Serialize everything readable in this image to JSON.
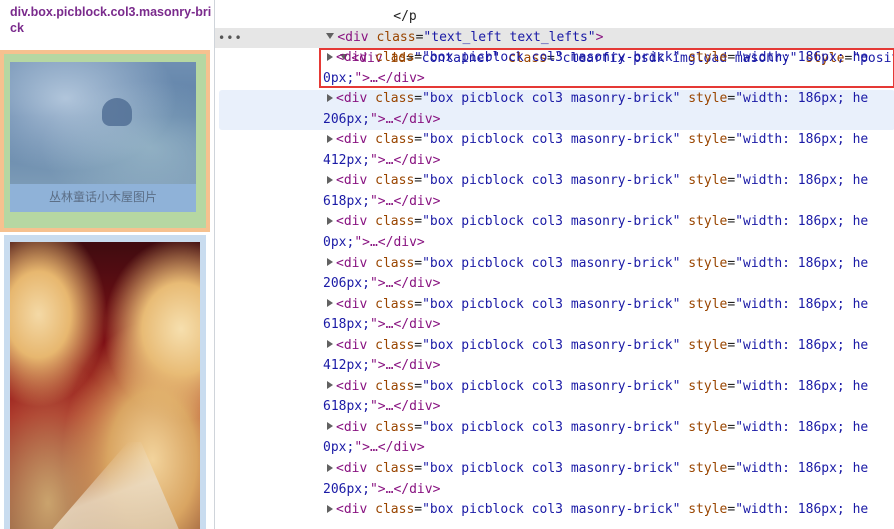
{
  "tooltip": {
    "text": "div.box.picblock.col3.masonry-brick"
  },
  "preview": {
    "card1_caption": "丛林童话小木屋图片"
  },
  "dom": {
    "top_line": {
      "tag": "div",
      "attr": "class",
      "value": "\"text_left text_lefts\""
    },
    "container_line": {
      "tag": "div",
      "attrs": [
        {
          "name": "id",
          "value": "\"container\""
        },
        {
          "name": "class",
          "value": "\"clearfix psdk imgload masonry\""
        },
        {
          "name": "style",
          "value": "\"posit"
        }
      ]
    },
    "brick_class_value": "\"box picblock col3 masonry-brick\"",
    "brick_style_prefix": "\"width: 186px; he",
    "brick_close": "\">…</div>",
    "bricks": [
      {
        "tail": "0px;"
      },
      {
        "tail": "206px;"
      },
      {
        "tail": "412px;"
      },
      {
        "tail": "618px;"
      },
      {
        "tail": "0px;"
      },
      {
        "tail": "206px;"
      },
      {
        "tail": "618px;"
      },
      {
        "tail": "412px;"
      },
      {
        "tail": "618px;"
      },
      {
        "tail": "0px;"
      },
      {
        "tail": "206px;"
      },
      {
        "tail": ""
      }
    ]
  },
  "colors": {
    "tag": "#881280",
    "attribute": "#994500",
    "value": "#1a1aa6",
    "selection_border": "#e53935"
  }
}
